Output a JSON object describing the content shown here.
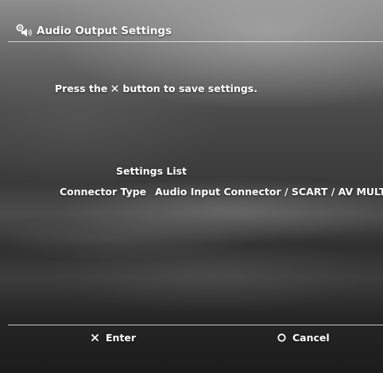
{
  "header": {
    "title": "Audio Output Settings",
    "icon": "audio-settings-icon"
  },
  "main": {
    "instruction_before": "Press the",
    "instruction_icon": "cross-button-icon",
    "instruction_after": "button to save settings.",
    "list_heading": "Settings List",
    "settings": [
      {
        "label": "Connector Type",
        "value": "Audio Input Connector / SCART / AV MULTI"
      }
    ]
  },
  "footer": {
    "enter_icon": "cross-button-icon",
    "enter_label": "Enter",
    "cancel_icon": "circle-button-icon",
    "cancel_label": "Cancel"
  }
}
